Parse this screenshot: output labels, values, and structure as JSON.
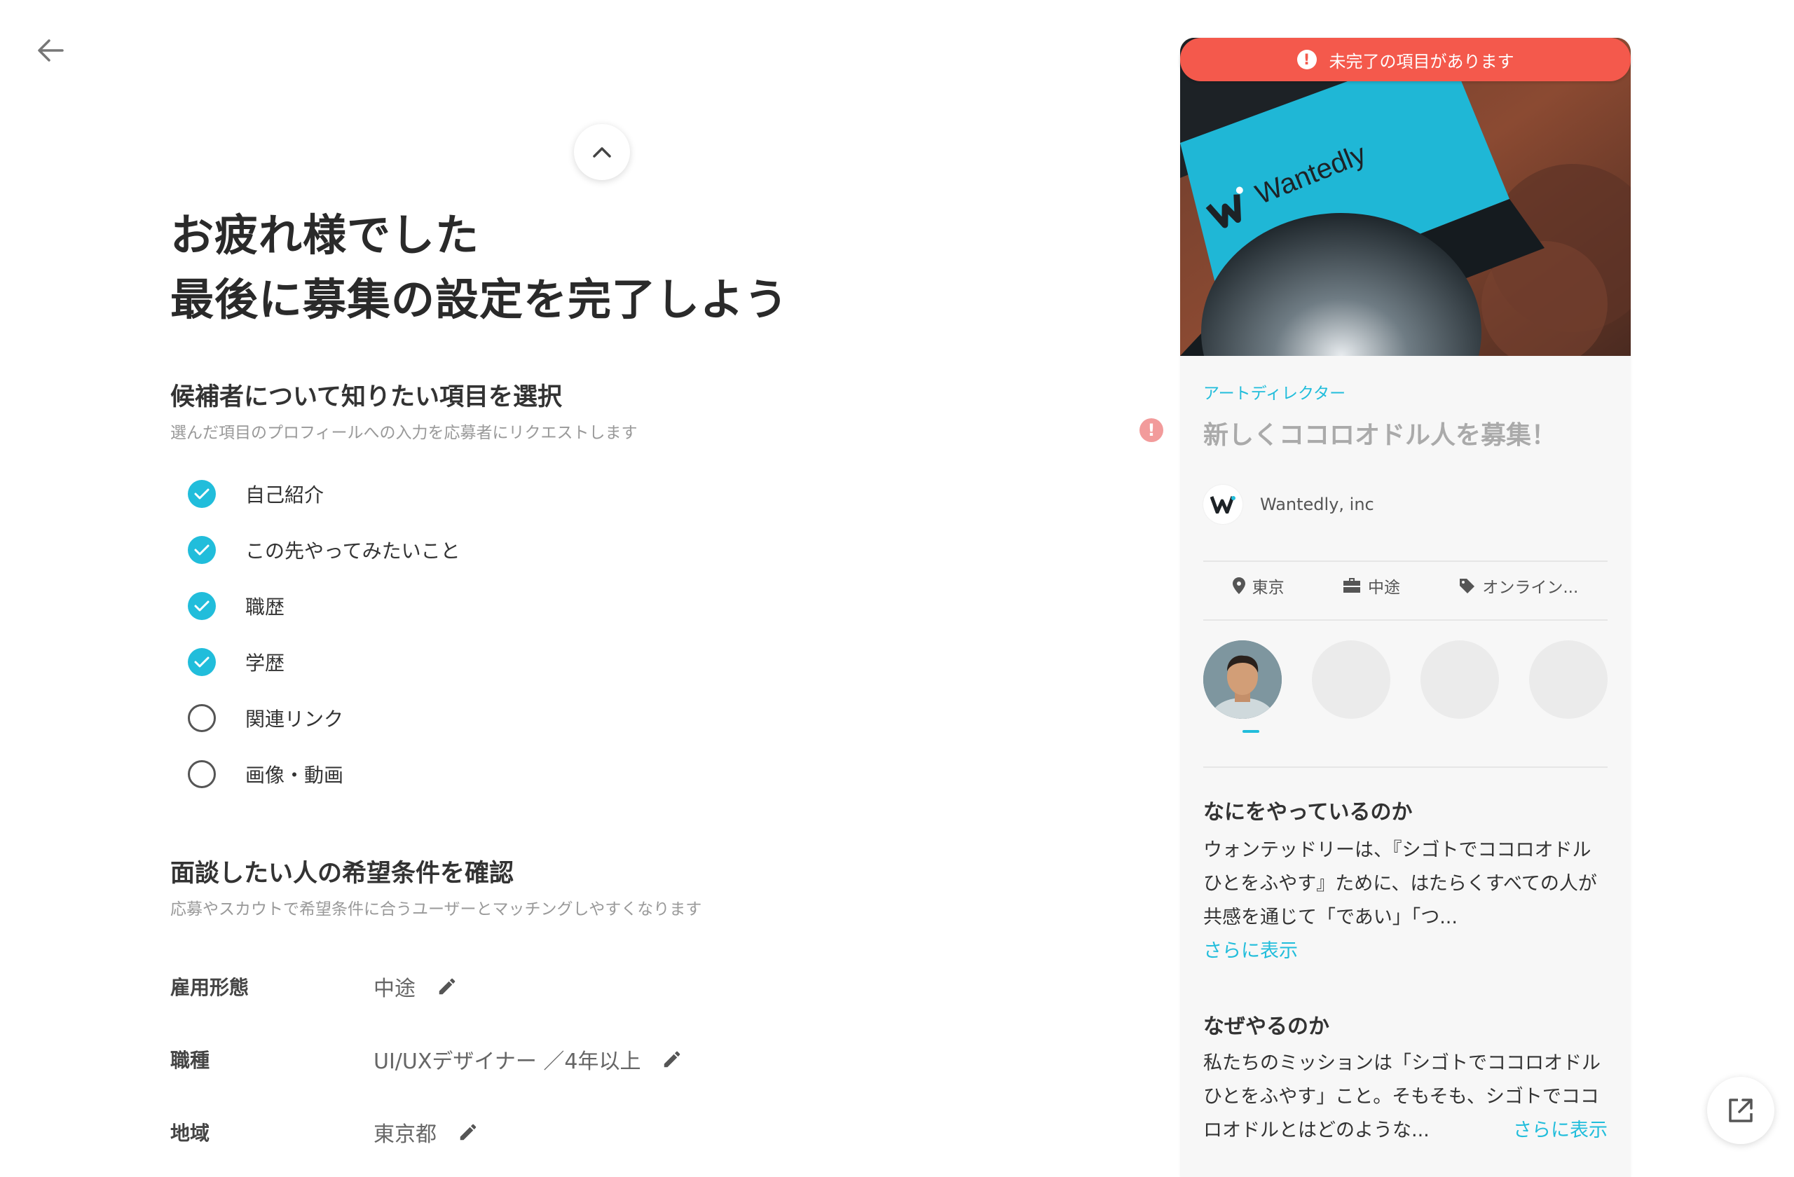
{
  "headline": {
    "line1": "お疲れ様でした",
    "line2": "最後に募集の設定を完了しよう"
  },
  "questions": {
    "title": "候補者について知りたい項目を選択",
    "subtitle": "選んだ項目のプロフィールへの入力を応募者にリクエストします",
    "items": [
      {
        "label": "自己紹介",
        "checked": true
      },
      {
        "label": "この先やってみたいこと",
        "checked": true
      },
      {
        "label": "職歴",
        "checked": true
      },
      {
        "label": "学歴",
        "checked": true
      },
      {
        "label": "関連リンク",
        "checked": false
      },
      {
        "label": "画像・動画",
        "checked": false
      }
    ]
  },
  "conditions": {
    "title": "面談したい人の希望条件を確認",
    "subtitle": "応募やスカウトで希望条件に合うユーザーとマッチングしやすくなります",
    "rows": [
      {
        "key": "雇用形態",
        "value": "中途"
      },
      {
        "key": "職種",
        "value": "UI/UXデザイナー ／4年以上"
      },
      {
        "key": "地域",
        "value": "東京都"
      }
    ]
  },
  "preview": {
    "alert": "未完了の項目があります",
    "hero_brand": "Wantedly",
    "category": "アートディレクター",
    "title": "新しくココロオドル人を募集！",
    "company": "Wantedly, inc",
    "tags": [
      {
        "icon": "location-pin-icon",
        "label": "東京"
      },
      {
        "icon": "briefcase-icon",
        "label": "中途"
      },
      {
        "icon": "tag-icon",
        "label": "オンライン..."
      }
    ],
    "section1_title": "なにをやっているのか",
    "section1_body": "ウォンテッドリーは、『シゴトでココロオドルひとをふやす』ために、はたらくすべての人が共感を通じて「であい」「つ...",
    "section1_more": "さらに表示",
    "section2_title": "なぜやるのか",
    "section2_body": "私たちのミッションは「シゴトでココロオドルひとをふやす」こと。そもそも、シゴトでココロオドルとはどのような...",
    "section2_more": "さらに表示"
  },
  "colors": {
    "accent": "#21bddb",
    "alert": "#f4594c",
    "error_dot": "#f29b9b"
  }
}
